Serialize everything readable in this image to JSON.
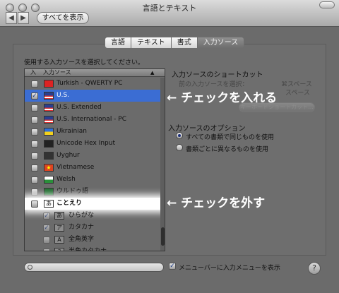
{
  "window": {
    "title": "言語とテキスト",
    "show_all": "すべてを表示"
  },
  "tabs": [
    {
      "label": "言語"
    },
    {
      "label": "テキスト"
    },
    {
      "label": "書式"
    },
    {
      "label": "入力ソース",
      "active": true
    }
  ],
  "panel": {
    "instruction": "使用する入力ソースを選択してください。",
    "list_header": {
      "col1": "入",
      "col2": "入力ソース"
    },
    "items": [
      {
        "label": "Turkish - QWERTY PC",
        "checked": false
      },
      {
        "label": "U.S.",
        "checked": true,
        "selected": true
      },
      {
        "label": "U.S. Extended",
        "checked": false
      },
      {
        "label": "U.S. International - PC",
        "checked": false
      },
      {
        "label": "Ukrainian",
        "checked": false
      },
      {
        "label": "Unicode Hex Input",
        "checked": false
      },
      {
        "label": "Uyghur",
        "checked": false
      },
      {
        "label": "Vietnamese",
        "checked": false
      },
      {
        "label": "Welsh",
        "checked": false
      },
      {
        "label": "ウルドゥ語",
        "checked": false
      },
      {
        "label": "ことえり",
        "checked": false,
        "highlighted": true
      },
      {
        "label": "ひらがな",
        "checked": true,
        "sub": true,
        "icon": "あ"
      },
      {
        "label": "カタカナ",
        "checked": true,
        "sub": true,
        "icon": "ア"
      },
      {
        "label": "全角英字",
        "checked": false,
        "sub": true,
        "icon": "A"
      },
      {
        "label": "半角カタカナ",
        "checked": false,
        "sub": true,
        "icon": "ｱ"
      }
    ],
    "shortcuts": {
      "heading": "入力ソースのショートカット",
      "prev_label": "前の入力ソースを選択：",
      "prev_key": "⌘スペース",
      "next_key": "スペース",
      "keyboard_button": "キーボードショートカット..."
    },
    "options": {
      "heading": "入力ソースのオプション",
      "all_docs": "すべての書類で同じものを使用",
      "per_doc": "書類ごとに異なるものを使用"
    },
    "show_menu": "メニューバーに入力メニューを表示"
  },
  "callouts": {
    "check_on": "← チェックを入れる",
    "check_off": "← チェックを外す"
  },
  "colors": {
    "selection": "#3b6dd3",
    "highlight": "#ffffff"
  }
}
